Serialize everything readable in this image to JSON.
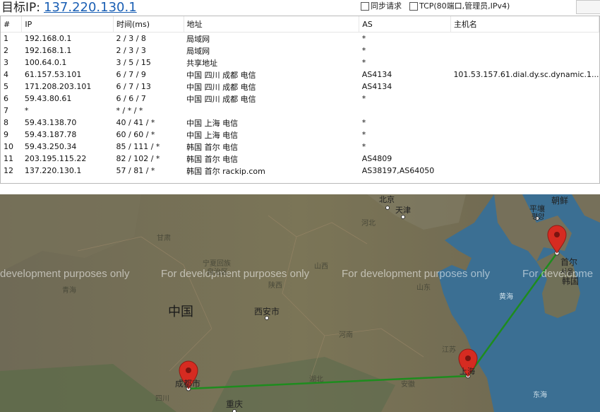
{
  "header": {
    "label": "目标IP:",
    "target_ip": "137.220.130.1",
    "sync_label": "同步请求",
    "tcp_label": "TCP(80端口,管理员,IPv4)"
  },
  "table": {
    "columns": [
      "#",
      "IP",
      "时间(ms)",
      "地址",
      "AS",
      "主机名"
    ],
    "rows": [
      [
        "1",
        "192.168.0.1",
        "2 / 3 / 8",
        "局域网",
        "*",
        ""
      ],
      [
        "2",
        "192.168.1.1",
        "2 / 3 / 3",
        "局域网",
        "*",
        ""
      ],
      [
        "3",
        "100.64.0.1",
        "3 / 5 / 15",
        "共享地址",
        "*",
        ""
      ],
      [
        "4",
        "61.157.53.101",
        "6 / 7 / 9",
        "中国 四川 成都 电信",
        "AS4134",
        "101.53.157.61.dial.dy.sc.dynamic.1..."
      ],
      [
        "5",
        "171.208.203.101",
        "6 / 7 / 13",
        "中国 四川 成都 电信",
        "AS4134",
        ""
      ],
      [
        "6",
        "59.43.80.61",
        "6 / 6 / 7",
        "中国 四川 成都 电信",
        "*",
        ""
      ],
      [
        "7",
        "*",
        "* / * / *",
        "",
        "",
        ""
      ],
      [
        "8",
        "59.43.138.70",
        "40 / 41 / *",
        "中国 上海 电信",
        "*",
        ""
      ],
      [
        "9",
        "59.43.187.78",
        "60 / 60 / *",
        "中国 上海 电信",
        "*",
        ""
      ],
      [
        "10",
        "59.43.250.34",
        "85 / 111 / *",
        "韩国 首尔 电信",
        "*",
        ""
      ],
      [
        "11",
        "203.195.115.22",
        "82 / 102 / *",
        "韩国 首尔 电信",
        "AS4809",
        ""
      ],
      [
        "12",
        "137.220.130.1",
        "57 / 81 / *",
        "韩国 首尔 rackip.com",
        "AS38197,AS64050",
        ""
      ]
    ]
  },
  "map": {
    "watermark": "For development purposes only",
    "watermark_clip": "development purposes only",
    "watermark_right": "For developme",
    "labels": {
      "beijing": "北京",
      "tianjin": "天津",
      "hebei": "河北",
      "chaoxian": "朝鲜",
      "pingrang": "平壤",
      "pingrang2": "평양",
      "gansu": "甘肃",
      "ningxia": "宁夏回族",
      "ningxia2": "自治区",
      "shanxi": "山西",
      "shaanxi": "陕西",
      "qinghai": "青海",
      "shandong": "山东",
      "huanghai": "黄海",
      "seoul": "首尔",
      "seoul2": "서울",
      "hanguo": "韩国",
      "zhongguo": "中国",
      "xian": "西安市",
      "henan": "河南",
      "jiangsu": "江苏",
      "shanghai": "上海",
      "anhui": "安徽",
      "hubei": "湖北",
      "chengdu": "成都市",
      "sichuan": "四川",
      "chongqing": "重庆",
      "donghai": "东海"
    },
    "route_color": "#1e8c1e",
    "pin_color": "#d62b21"
  }
}
